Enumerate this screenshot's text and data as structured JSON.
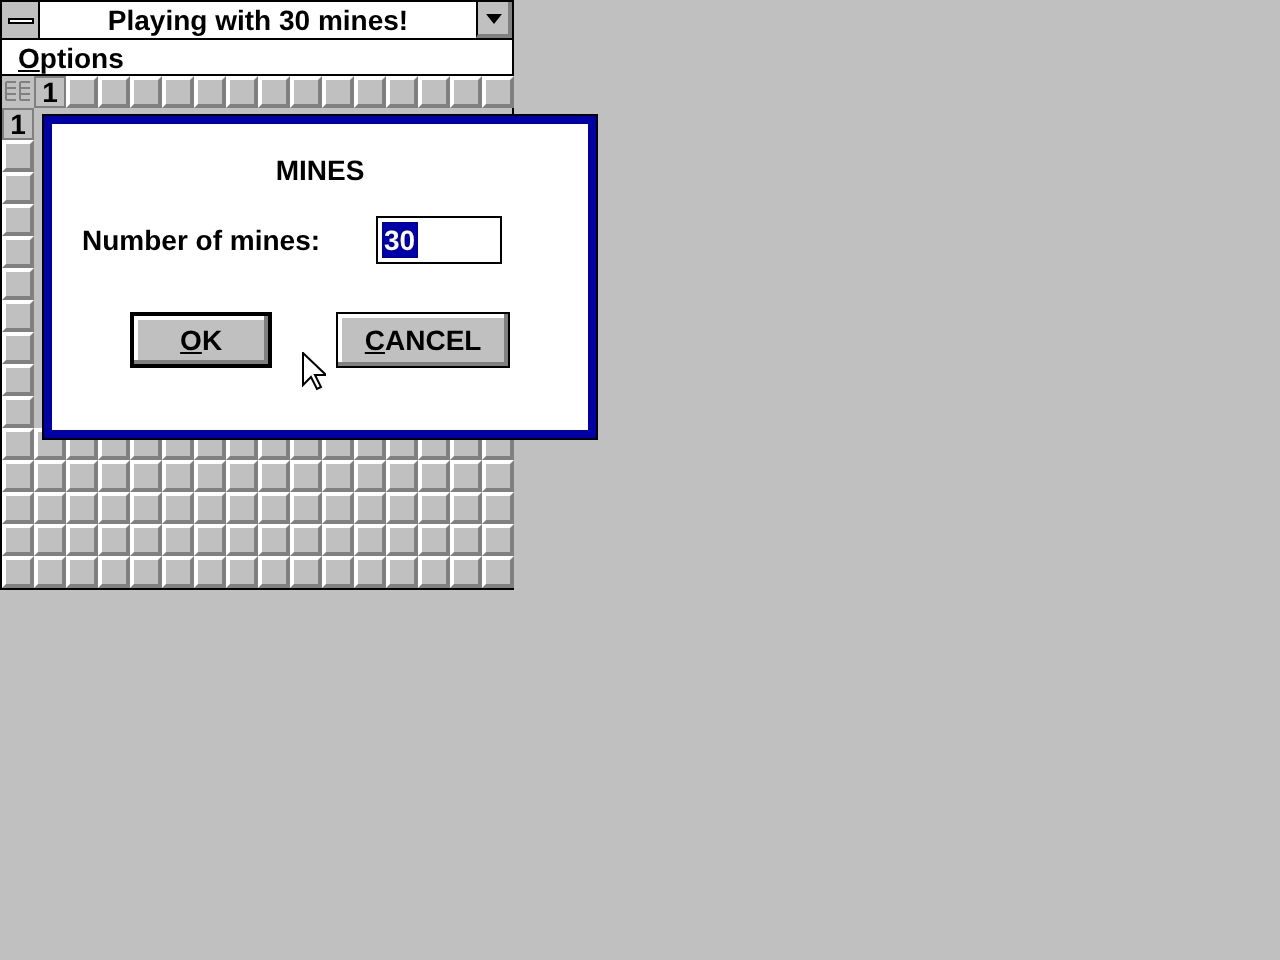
{
  "window": {
    "title": "Playing with 30 mines!"
  },
  "menu": [
    {
      "mnemonic": "O",
      "rest": "ptions"
    }
  ],
  "board": {
    "rows": [
      [
        {
          "kind": "corner"
        },
        {
          "kind": "revealed",
          "text": "1"
        },
        {
          "kind": "hidden"
        },
        {
          "kind": "hidden"
        },
        {
          "kind": "hidden"
        },
        {
          "kind": "hidden"
        },
        {
          "kind": "hidden"
        },
        {
          "kind": "hidden"
        },
        {
          "kind": "hidden"
        },
        {
          "kind": "hidden"
        },
        {
          "kind": "hidden"
        },
        {
          "kind": "hidden"
        },
        {
          "kind": "hidden"
        },
        {
          "kind": "hidden"
        },
        {
          "kind": "hidden"
        },
        {
          "kind": "hidden"
        }
      ],
      [
        {
          "kind": "revealed",
          "text": "1"
        }
      ],
      [
        {
          "kind": "hidden"
        }
      ],
      [
        {
          "kind": "hidden"
        }
      ],
      [
        {
          "kind": "hidden"
        }
      ],
      [
        {
          "kind": "hidden"
        }
      ],
      [
        {
          "kind": "hidden"
        }
      ],
      [
        {
          "kind": "hidden"
        }
      ],
      [
        {
          "kind": "hidden"
        }
      ],
      [
        {
          "kind": "hidden"
        }
      ],
      [
        {
          "kind": "hidden"
        }
      ],
      [
        {
          "kind": "hidden"
        },
        {
          "kind": "hidden"
        },
        {
          "kind": "hidden"
        },
        {
          "kind": "hidden"
        },
        {
          "kind": "hidden"
        },
        {
          "kind": "hidden"
        },
        {
          "kind": "hidden"
        },
        {
          "kind": "hidden"
        },
        {
          "kind": "hidden"
        },
        {
          "kind": "hidden"
        },
        {
          "kind": "hidden"
        },
        {
          "kind": "hidden"
        },
        {
          "kind": "hidden"
        },
        {
          "kind": "hidden"
        },
        {
          "kind": "hidden"
        },
        {
          "kind": "hidden"
        }
      ],
      [
        {
          "kind": "hidden"
        },
        {
          "kind": "hidden"
        },
        {
          "kind": "hidden"
        },
        {
          "kind": "hidden"
        },
        {
          "kind": "hidden"
        },
        {
          "kind": "hidden"
        },
        {
          "kind": "hidden"
        },
        {
          "kind": "hidden"
        },
        {
          "kind": "hidden"
        },
        {
          "kind": "hidden"
        },
        {
          "kind": "hidden"
        },
        {
          "kind": "hidden"
        },
        {
          "kind": "hidden"
        },
        {
          "kind": "hidden"
        },
        {
          "kind": "hidden"
        },
        {
          "kind": "hidden"
        }
      ],
      [
        {
          "kind": "hidden"
        },
        {
          "kind": "hidden"
        },
        {
          "kind": "hidden"
        },
        {
          "kind": "hidden"
        },
        {
          "kind": "hidden"
        },
        {
          "kind": "hidden"
        },
        {
          "kind": "hidden"
        },
        {
          "kind": "hidden"
        },
        {
          "kind": "hidden"
        },
        {
          "kind": "hidden"
        },
        {
          "kind": "hidden"
        },
        {
          "kind": "hidden"
        },
        {
          "kind": "hidden"
        },
        {
          "kind": "hidden"
        },
        {
          "kind": "hidden"
        },
        {
          "kind": "hidden"
        }
      ],
      [
        {
          "kind": "hidden"
        },
        {
          "kind": "hidden"
        },
        {
          "kind": "hidden"
        },
        {
          "kind": "hidden"
        },
        {
          "kind": "hidden"
        },
        {
          "kind": "hidden"
        },
        {
          "kind": "hidden"
        },
        {
          "kind": "hidden"
        },
        {
          "kind": "hidden"
        },
        {
          "kind": "hidden"
        },
        {
          "kind": "hidden"
        },
        {
          "kind": "hidden"
        },
        {
          "kind": "hidden"
        },
        {
          "kind": "hidden"
        },
        {
          "kind": "hidden"
        },
        {
          "kind": "hidden"
        }
      ],
      [
        {
          "kind": "hidden"
        },
        {
          "kind": "hidden"
        },
        {
          "kind": "hidden"
        },
        {
          "kind": "hidden"
        },
        {
          "kind": "hidden"
        },
        {
          "kind": "hidden"
        },
        {
          "kind": "hidden"
        },
        {
          "kind": "hidden"
        },
        {
          "kind": "hidden"
        },
        {
          "kind": "hidden"
        },
        {
          "kind": "hidden"
        },
        {
          "kind": "hidden"
        },
        {
          "kind": "hidden"
        },
        {
          "kind": "hidden"
        },
        {
          "kind": "hidden"
        },
        {
          "kind": "hidden"
        }
      ]
    ]
  },
  "dialog": {
    "title": "MINES",
    "label": "Number of mines:",
    "field": {
      "value": "30",
      "selected": true
    },
    "buttons": [
      {
        "mnemonic": "O",
        "rest": "K",
        "default": true
      },
      {
        "mnemonic": "C",
        "rest": "ANCEL",
        "default": false
      }
    ]
  }
}
